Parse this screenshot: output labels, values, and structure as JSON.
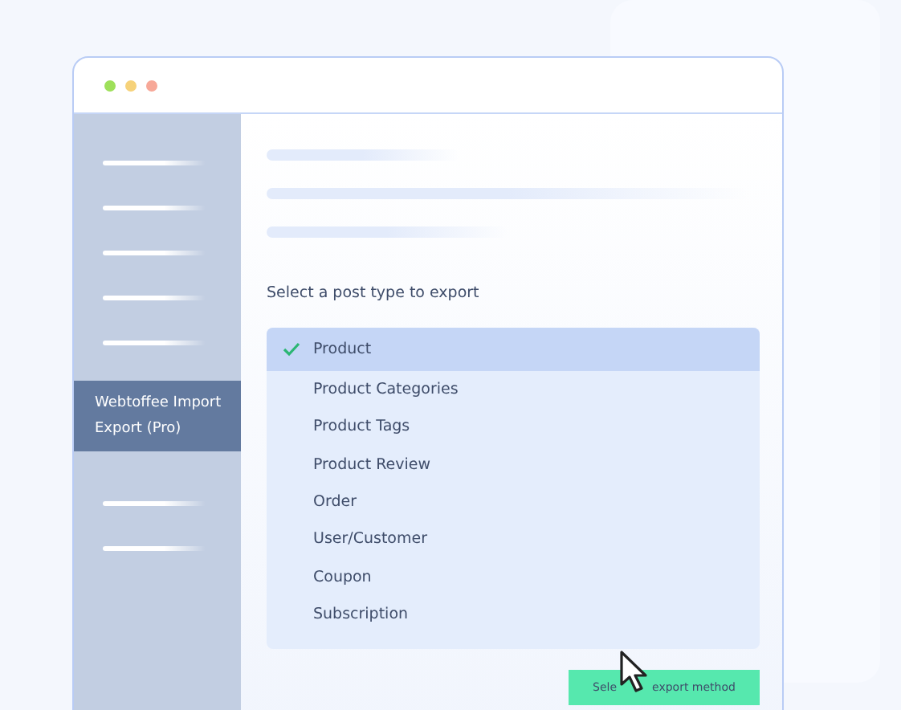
{
  "sidebar": {
    "items": [
      {
        "kind": "line"
      },
      {
        "kind": "line"
      },
      {
        "kind": "line"
      },
      {
        "kind": "line"
      },
      {
        "kind": "line"
      },
      {
        "kind": "label",
        "label": "Webtoffee Import Export (Pro)",
        "selected": true
      },
      {
        "kind": "line"
      },
      {
        "kind": "line"
      }
    ]
  },
  "prompt": "Select a post type to export",
  "post_types": [
    {
      "label": "Product",
      "selected": true
    },
    {
      "label": "Product Categories",
      "selected": false
    },
    {
      "label": "Product Tags",
      "selected": false
    },
    {
      "label": "Product Review",
      "selected": false
    },
    {
      "label": "Order",
      "selected": false
    },
    {
      "label": "User/Customer",
      "selected": false
    },
    {
      "label": "Coupon",
      "selected": false
    },
    {
      "label": "Subscription",
      "selected": false
    }
  ],
  "button": {
    "label_before_cursor": "Sele",
    "label_after_cursor": "export method"
  }
}
